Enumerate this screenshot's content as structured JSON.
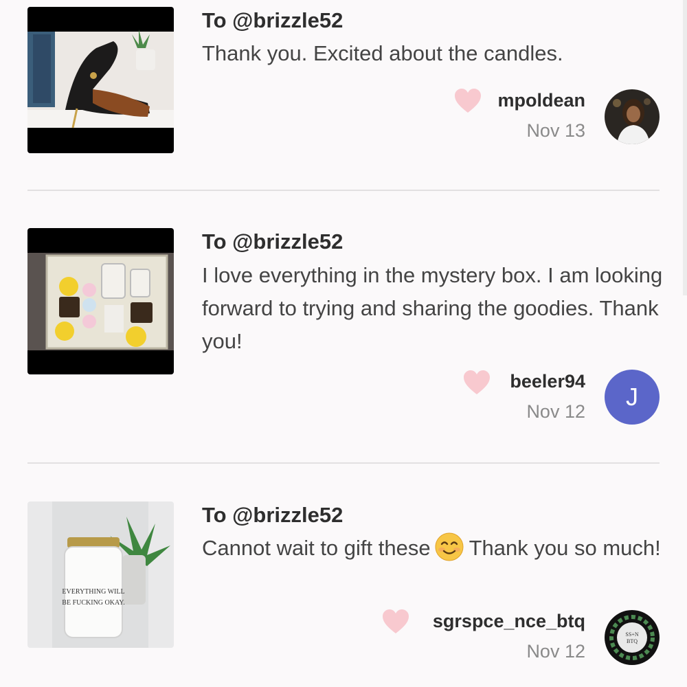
{
  "reviews": [
    {
      "to": "To @brizzle52",
      "message": "Thank you. Excited about the candles.",
      "username": "mpoldean",
      "date": "Nov 13",
      "thumbnail": "shoes-photo",
      "avatar": "user-photo"
    },
    {
      "to": "To @brizzle52",
      "message": "I love everything in the mystery box. I am looking forward to trying and sharing the goodies. Thank you!",
      "username": "beeler94",
      "date": "Nov 12",
      "thumbnail": "mystery-box-photo",
      "avatar_letter": "J",
      "avatar_color": "#5b66c9"
    },
    {
      "to": "To @brizzle52",
      "message_before": "Cannot wait to gift these",
      "message_after": "Thank you so much!",
      "emoji": "smiling-face-emoji",
      "username": "sgrspce_nce_btq",
      "date": "Nov 12",
      "thumbnail": "candle-photo",
      "thumbnail_text": "EVERYTHING WILL BE FUCKING OKAY.",
      "avatar": "shop-logo",
      "avatar_text": "SS+N BTQ"
    }
  ],
  "colors": {
    "heart": "#f8c9cf",
    "accent_avatar": "#5b66c9",
    "divider": "#e2e0e1"
  }
}
